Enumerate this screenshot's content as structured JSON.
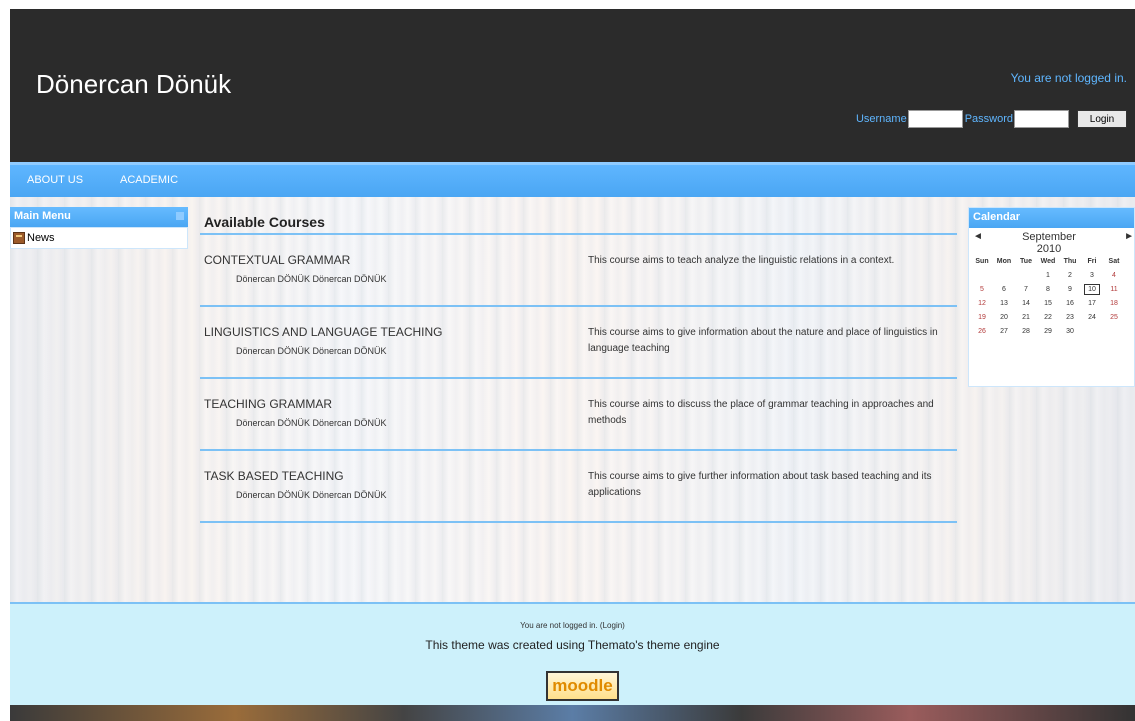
{
  "header": {
    "site_title": "Dönercan Dönük",
    "login_status": "You are not logged in.",
    "username_label": "Username",
    "password_label": "Password",
    "login_button": "Login"
  },
  "nav": {
    "items": [
      "ABOUT US",
      "ACADEMIC"
    ]
  },
  "main_menu": {
    "title": "Main Menu",
    "items": [
      {
        "label": "News",
        "icon": "news-icon"
      }
    ]
  },
  "courses": {
    "title": "Available Courses",
    "list": [
      {
        "name": "CONTEXTUAL GRAMMAR",
        "teachers": "Dönercan DÖNÜK Dönercan DÖNÜK",
        "description": "This course aims to teach analyze the linguistic relations in a context."
      },
      {
        "name": "LINGUISTICS AND LANGUAGE TEACHING",
        "teachers": "Dönercan DÖNÜK Dönercan DÖNÜK",
        "description": "This course aims to give information about the nature and place of linguistics in language teaching"
      },
      {
        "name": "TEACHING GRAMMAR",
        "teachers": "Dönercan DÖNÜK Dönercan DÖNÜK",
        "description": "This course aims to discuss the place of grammar teaching in approaches and methods"
      },
      {
        "name": "TASK BASED TEACHING",
        "teachers": "Dönercan DÖNÜK Dönercan DÖNÜK",
        "description": "This course aims to give further information about task based teaching and its applications"
      }
    ]
  },
  "calendar": {
    "title": "Calendar",
    "month": "September 2010",
    "prev": "◄",
    "next": "►",
    "weekdays": [
      "Sun",
      "Mon",
      "Tue",
      "Wed",
      "Thu",
      "Fri",
      "Sat"
    ],
    "weeks": [
      [
        "",
        "",
        "",
        "1",
        "2",
        "3",
        "4"
      ],
      [
        "5",
        "6",
        "7",
        "8",
        "9",
        "10",
        "11"
      ],
      [
        "12",
        "13",
        "14",
        "15",
        "16",
        "17",
        "18"
      ],
      [
        "19",
        "20",
        "21",
        "22",
        "23",
        "24",
        "25"
      ],
      [
        "26",
        "27",
        "28",
        "29",
        "30",
        "",
        ""
      ]
    ],
    "today": "10"
  },
  "footer": {
    "status": "You are not logged in. (Login)",
    "theme_credit": "This theme was created using Themato's theme engine",
    "logo_text": "moodle"
  },
  "colors": {
    "header_bg": "#2b2b2b",
    "accent_blue": "#5fb6ff",
    "footer_bg": "#cdf1fb"
  }
}
